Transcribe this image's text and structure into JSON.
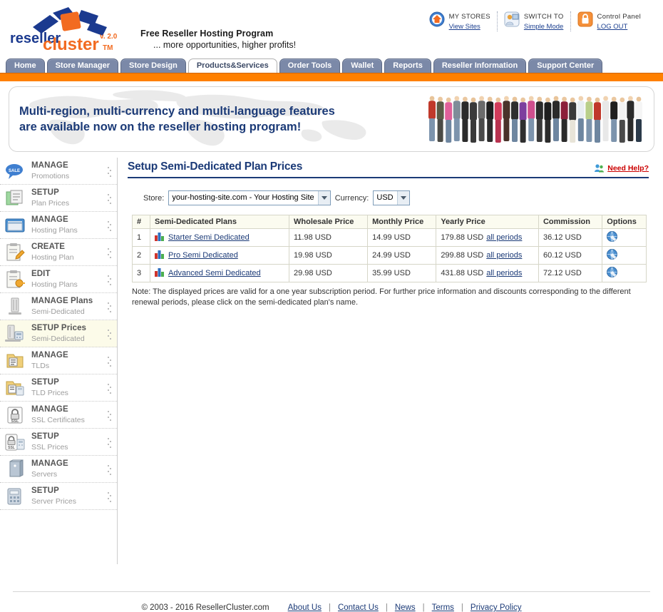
{
  "brand": {
    "name_part1": "reseller",
    "name_part2": "cluster",
    "version": "v. 2.0",
    "tm": "TM"
  },
  "header": {
    "tagline_line1": "Free Reseller Hosting Program",
    "tagline_line2": "... more opportunities, higher profits!",
    "tools": [
      {
        "icon": "home-circle-icon",
        "label": "MY STORES",
        "link": "View Sites"
      },
      {
        "icon": "user-switch-icon",
        "label": "SWITCH TO",
        "link": "Simple Mode"
      },
      {
        "icon": "padlock-icon",
        "label": "Control Panel",
        "link": "LOG OUT"
      }
    ]
  },
  "nav": {
    "tabs": [
      {
        "label": "Home",
        "active": false
      },
      {
        "label": "Store Manager",
        "active": false
      },
      {
        "label": "Store Design",
        "active": false
      },
      {
        "label": "Products&Services",
        "active": true
      },
      {
        "label": "Order Tools",
        "active": false
      },
      {
        "label": "Wallet",
        "active": false
      },
      {
        "label": "Reports",
        "active": false
      },
      {
        "label": "Reseller Information",
        "active": false
      },
      {
        "label": "Support Center",
        "active": false
      }
    ]
  },
  "banner": {
    "line1": "Multi-region, multi-currency and multi-language features",
    "line2": "are available now on the reseller hosting program!"
  },
  "sidebar": {
    "items": [
      {
        "icon": "sale-tag-icon",
        "line1": "MANAGE",
        "line2": "Promotions",
        "active": false
      },
      {
        "icon": "plan-prices-icon",
        "line1": "SETUP",
        "line2": "Plan Prices",
        "active": false
      },
      {
        "icon": "hosting-plans-icon",
        "line1": "MANAGE",
        "line2": "Hosting Plans",
        "active": false
      },
      {
        "icon": "create-plan-icon",
        "line1": "CREATE",
        "line2": "Hosting Plan",
        "active": false
      },
      {
        "icon": "edit-plan-icon",
        "line1": "EDIT",
        "line2": "Hosting Plans",
        "active": false
      },
      {
        "icon": "server-rack-icon",
        "line1": "MANAGE Plans",
        "line2": "Semi-Dedicated",
        "active": false
      },
      {
        "icon": "server-price-icon",
        "line1": "SETUP Prices",
        "line2": "Semi-Dedicated",
        "active": true
      },
      {
        "icon": "tld-folder-icon",
        "line1": "MANAGE",
        "line2": "TLDs",
        "active": false
      },
      {
        "icon": "tld-price-icon",
        "line1": "SETUP",
        "line2": "TLD Prices",
        "active": false
      },
      {
        "icon": "ssl-lock-icon",
        "line1": "MANAGE",
        "line2": "SSL Certificates",
        "active": false
      },
      {
        "icon": "ssl-price-icon",
        "line1": "SETUP",
        "line2": "SSL Prices",
        "active": false
      },
      {
        "icon": "server-box-icon",
        "line1": "MANAGE",
        "line2": "Servers",
        "active": false
      },
      {
        "icon": "server-setup-icon",
        "line1": "SETUP",
        "line2": "Server Prices",
        "active": false
      }
    ]
  },
  "main": {
    "title": "Setup Semi-Dedicated Plan Prices",
    "help_icon": "help-people-icon",
    "help_label": "Need Help?",
    "filters": {
      "store_label": "Store:",
      "store_value": "your-hosting-site.com - Your Hosting Site",
      "currency_label": "Currency:",
      "currency_value": "USD"
    },
    "table": {
      "headers": [
        "#",
        "Semi-Dedicated Plans",
        "Wholesale Price",
        "Monthly Price",
        "Yearly Price",
        "Commission",
        "Options"
      ],
      "all_periods_label": "all periods",
      "row_icon": "plan-blocks-icon",
      "options_icon": "details-globe-icon",
      "rows": [
        {
          "num": "1",
          "plan": "Starter Semi Dedicated",
          "wholesale": "11.98 USD",
          "monthly": "14.99 USD",
          "yearly": "179.88 USD",
          "commission": "36.12 USD"
        },
        {
          "num": "2",
          "plan": "Pro Semi Dedicated",
          "wholesale": "19.98 USD",
          "monthly": "24.99 USD",
          "yearly": "299.88 USD",
          "commission": "60.12 USD"
        },
        {
          "num": "3",
          "plan": "Advanced Semi Dedicated",
          "wholesale": "29.98 USD",
          "monthly": "35.99 USD",
          "yearly": "431.88 USD",
          "commission": "72.12 USD"
        }
      ]
    },
    "note": "Note: The displayed prices are valid for a one year subscription period. For further price information and discounts corresponding to the different renewal periods, please click on the semi-dedicated plan's name."
  },
  "footer": {
    "copyright": "© 2003 - 2016 ResellerCluster.com",
    "links": [
      "About Us",
      "Contact Us",
      "News",
      "Terms",
      "Privacy Policy"
    ],
    "separator": "|"
  },
  "colors": {
    "orange": "#ff8000",
    "navy": "#1b3a77",
    "tab_blue": "#7b89a8",
    "help_red": "#cc0000"
  }
}
